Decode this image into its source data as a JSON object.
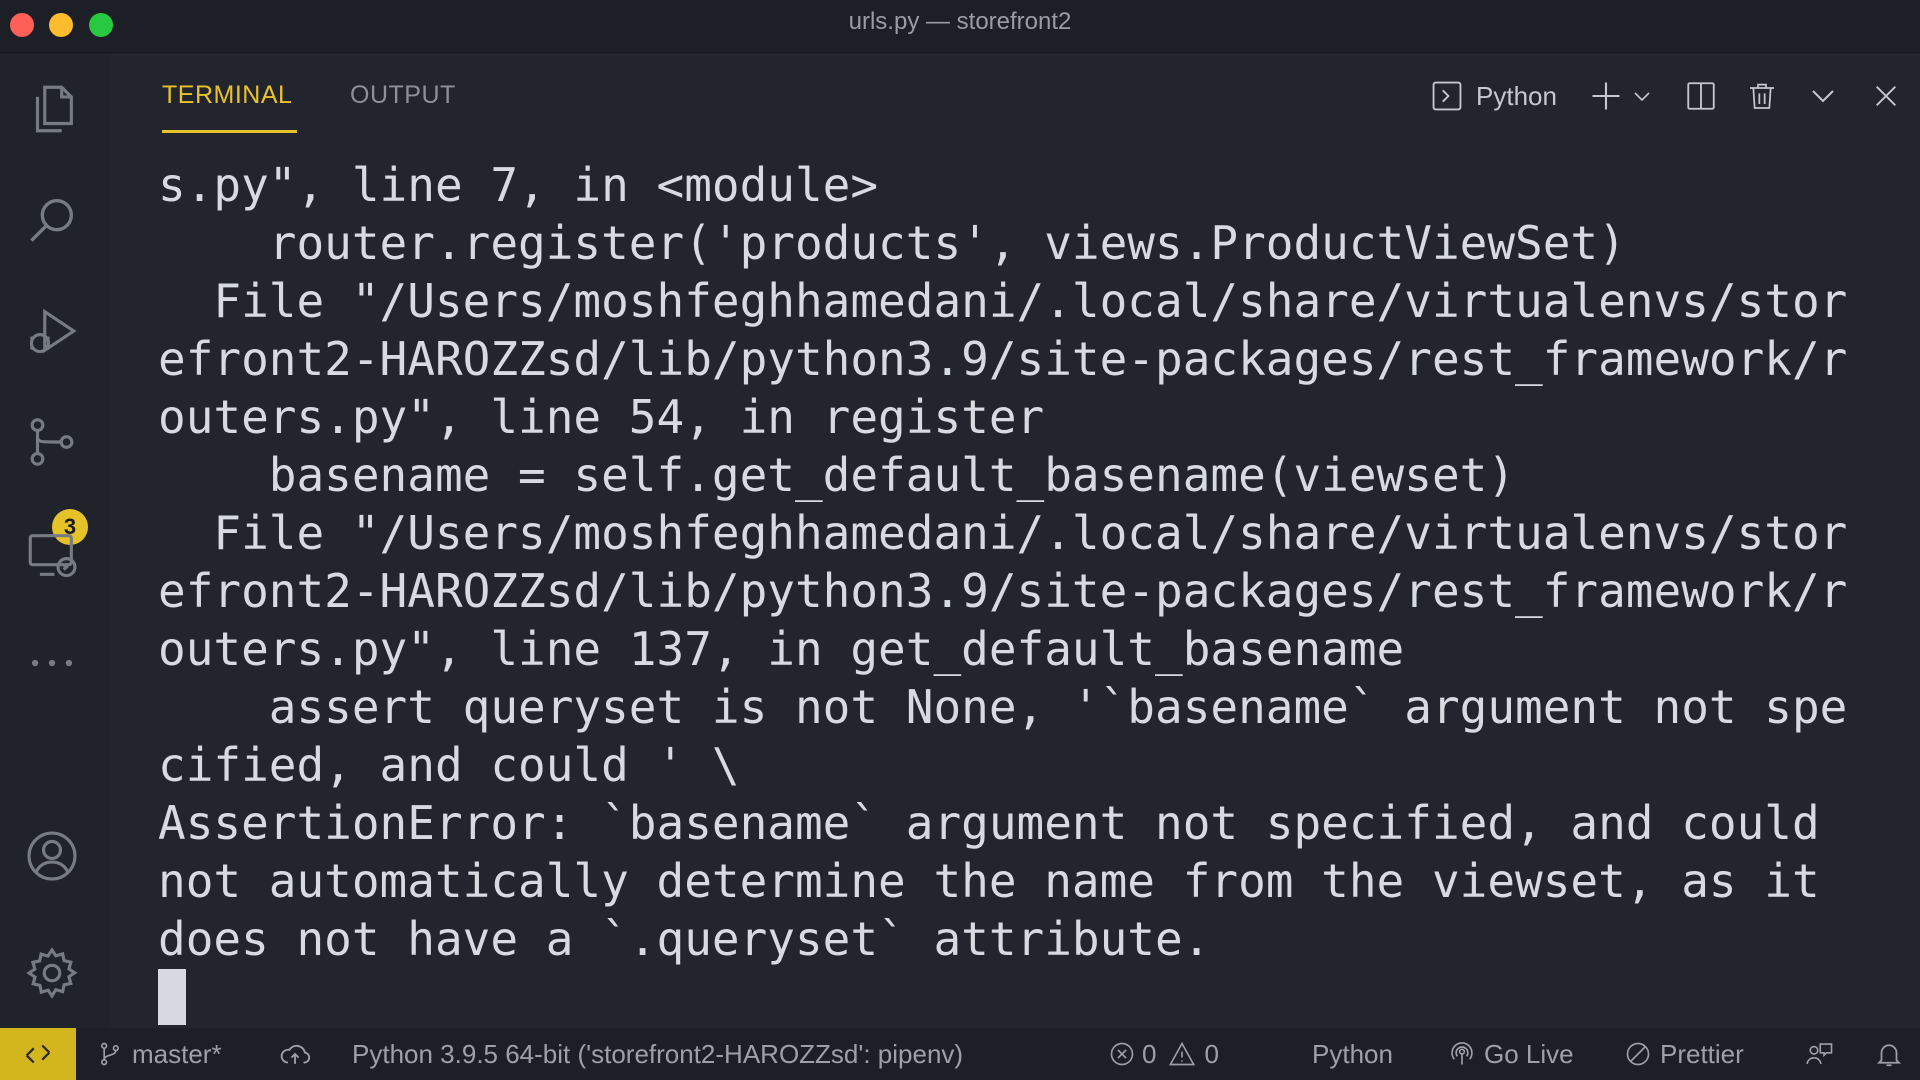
{
  "window": {
    "title": "urls.py — storefront2",
    "traffic_lights": {
      "close": "#fe5f57",
      "minimize": "#febc2e",
      "maximize": "#28c840"
    }
  },
  "activity_bar": {
    "items": [
      {
        "icon": "files-icon"
      },
      {
        "icon": "search-icon"
      },
      {
        "icon": "run-debug-icon"
      },
      {
        "icon": "source-control-icon",
        "badge": "3"
      },
      {
        "icon": "remote-explorer-icon"
      },
      {
        "icon": "more-icon"
      },
      {
        "icon": "accounts-icon"
      },
      {
        "icon": "settings-gear-icon"
      }
    ]
  },
  "panel": {
    "tabs": [
      {
        "label": "TERMINAL",
        "active": true
      },
      {
        "label": "OUTPUT",
        "active": false
      }
    ],
    "toolbar": {
      "shell_label": "Python",
      "icons": [
        "terminal-shell-icon",
        "new-terminal-plus-icon",
        "launch-profile-chevron-icon",
        "split-terminal-icon",
        "kill-terminal-trash-icon",
        "maximize-panel-chevron-icon",
        "close-panel-icon"
      ]
    }
  },
  "terminal": {
    "lines": [
      "s.py\", line 7, in <module>",
      "    router.register('products', views.ProductViewSet)",
      "  File \"/Users/moshfeghhamedani/.local/share/virtualenvs/stor",
      "efront2-HAROZZsd/lib/python3.9/site-packages/rest_framework/r",
      "outers.py\", line 54, in register",
      "    basename = self.get_default_basename(viewset)",
      "  File \"/Users/moshfeghhamedani/.local/share/virtualenvs/stor",
      "efront2-HAROZZsd/lib/python3.9/site-packages/rest_framework/r",
      "outers.py\", line 137, in get_default_basename",
      "    assert queryset is not None, '`basename` argument not spe",
      "cified, and could ' \\",
      "AssertionError: `basename` argument not specified, and could",
      "not automatically determine the name from the viewset, as it",
      "does not have a `.queryset` attribute."
    ]
  },
  "status_bar": {
    "branch": "master*",
    "interpreter": "Python 3.9.5 64-bit ('storefront2-HAROZZsd': pipenv)",
    "errors": "0",
    "warnings": "0",
    "language": "Python",
    "go_live": "Go Live",
    "prettier": "Prettier",
    "colors": {
      "remote_button": "#d3b51d"
    }
  }
}
